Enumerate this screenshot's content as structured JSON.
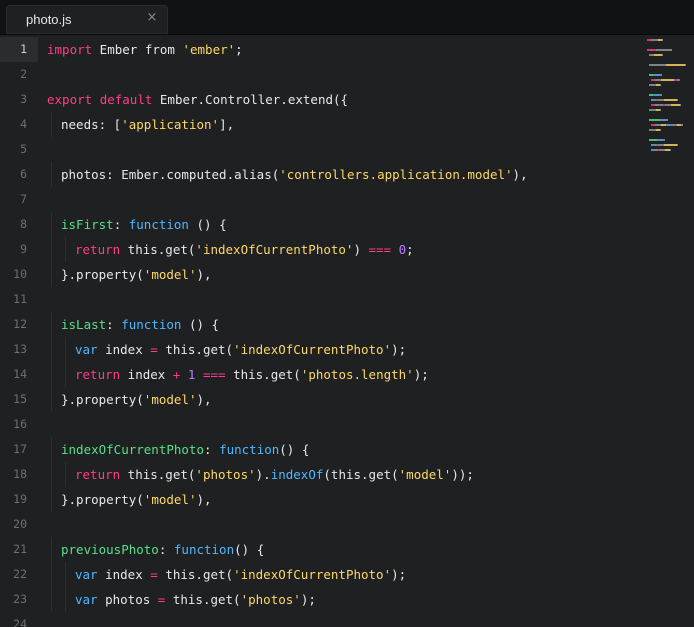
{
  "tab": {
    "title": "photo.js",
    "close_glyph": "×"
  },
  "editor": {
    "active_line": 1,
    "lines": [
      {
        "n": "1",
        "indent": 0,
        "tokens": [
          [
            "kw",
            "import"
          ],
          [
            "txt",
            " Ember "
          ],
          [
            "txt",
            "from "
          ],
          [
            "str",
            "'ember'"
          ],
          [
            "txt",
            ";"
          ]
        ]
      },
      {
        "n": "2",
        "indent": 0,
        "tokens": []
      },
      {
        "n": "3",
        "indent": 0,
        "tokens": [
          [
            "kw",
            "export"
          ],
          [
            "txt",
            " "
          ],
          [
            "kw",
            "default"
          ],
          [
            "txt",
            " Ember.Controller.extend({"
          ]
        ]
      },
      {
        "n": "4",
        "indent": 1,
        "tokens": [
          [
            "txt",
            "needs: ["
          ],
          [
            "str",
            "'application'"
          ],
          [
            "txt",
            "],"
          ]
        ]
      },
      {
        "n": "5",
        "indent": 0,
        "tokens": []
      },
      {
        "n": "6",
        "indent": 1,
        "tokens": [
          [
            "txt",
            "photos: Ember.computed.alias("
          ],
          [
            "str",
            "'controllers.application.model'"
          ],
          [
            "txt",
            "),"
          ]
        ]
      },
      {
        "n": "7",
        "indent": 0,
        "tokens": []
      },
      {
        "n": "8",
        "indent": 1,
        "tokens": [
          [
            "prop",
            "isFirst"
          ],
          [
            "txt",
            ": "
          ],
          [
            "fn",
            "function"
          ],
          [
            "txt",
            " () {"
          ]
        ]
      },
      {
        "n": "9",
        "indent": 2,
        "tokens": [
          [
            "kw",
            "return"
          ],
          [
            "txt",
            " this.get("
          ],
          [
            "str",
            "'indexOfCurrentPhoto'"
          ],
          [
            "txt",
            ") "
          ],
          [
            "op",
            "==="
          ],
          [
            "txt",
            " "
          ],
          [
            "num",
            "0"
          ],
          [
            "txt",
            ";"
          ]
        ]
      },
      {
        "n": "10",
        "indent": 1,
        "tokens": [
          [
            "txt",
            "}.property("
          ],
          [
            "str",
            "'model'"
          ],
          [
            "txt",
            "),"
          ]
        ]
      },
      {
        "n": "11",
        "indent": 0,
        "tokens": []
      },
      {
        "n": "12",
        "indent": 1,
        "tokens": [
          [
            "prop",
            "isLast"
          ],
          [
            "txt",
            ": "
          ],
          [
            "fn",
            "function"
          ],
          [
            "txt",
            " () {"
          ]
        ]
      },
      {
        "n": "13",
        "indent": 2,
        "tokens": [
          [
            "fn",
            "var"
          ],
          [
            "txt",
            " index "
          ],
          [
            "op",
            "="
          ],
          [
            "txt",
            " this.get("
          ],
          [
            "str",
            "'indexOfCurrentPhoto'"
          ],
          [
            "txt",
            ");"
          ]
        ]
      },
      {
        "n": "14",
        "indent": 2,
        "tokens": [
          [
            "kw",
            "return"
          ],
          [
            "txt",
            " index "
          ],
          [
            "op",
            "+"
          ],
          [
            "txt",
            " "
          ],
          [
            "num",
            "1"
          ],
          [
            "txt",
            " "
          ],
          [
            "op",
            "==="
          ],
          [
            "txt",
            " this.get("
          ],
          [
            "str",
            "'photos.length'"
          ],
          [
            "txt",
            ");"
          ]
        ]
      },
      {
        "n": "15",
        "indent": 1,
        "tokens": [
          [
            "txt",
            "}.property("
          ],
          [
            "str",
            "'model'"
          ],
          [
            "txt",
            "),"
          ]
        ]
      },
      {
        "n": "16",
        "indent": 0,
        "tokens": []
      },
      {
        "n": "17",
        "indent": 1,
        "tokens": [
          [
            "prop",
            "indexOfCurrentPhoto"
          ],
          [
            "txt",
            ": "
          ],
          [
            "fn",
            "function"
          ],
          [
            "txt",
            "() {"
          ]
        ]
      },
      {
        "n": "18",
        "indent": 2,
        "tokens": [
          [
            "kw",
            "return"
          ],
          [
            "txt",
            " this.get("
          ],
          [
            "str",
            "'photos'"
          ],
          [
            "txt",
            ")."
          ],
          [
            "meth",
            "indexOf"
          ],
          [
            "txt",
            "(this.get("
          ],
          [
            "str",
            "'model'"
          ],
          [
            "txt",
            "));"
          ]
        ]
      },
      {
        "n": "19",
        "indent": 1,
        "tokens": [
          [
            "txt",
            "}.property("
          ],
          [
            "str",
            "'model'"
          ],
          [
            "txt",
            "),"
          ]
        ]
      },
      {
        "n": "20",
        "indent": 0,
        "tokens": []
      },
      {
        "n": "21",
        "indent": 1,
        "tokens": [
          [
            "prop",
            "previousPhoto"
          ],
          [
            "txt",
            ": "
          ],
          [
            "fn",
            "function"
          ],
          [
            "txt",
            "() {"
          ]
        ]
      },
      {
        "n": "22",
        "indent": 2,
        "tokens": [
          [
            "fn",
            "var"
          ],
          [
            "txt",
            " index "
          ],
          [
            "op",
            "="
          ],
          [
            "txt",
            " this.get("
          ],
          [
            "str",
            "'indexOfCurrentPhoto'"
          ],
          [
            "txt",
            ");"
          ]
        ]
      },
      {
        "n": "23",
        "indent": 2,
        "tokens": [
          [
            "fn",
            "var"
          ],
          [
            "txt",
            " photos "
          ],
          [
            "op",
            "="
          ],
          [
            "txt",
            " this.get("
          ],
          [
            "str",
            "'photos'"
          ],
          [
            "txt",
            ");"
          ]
        ]
      },
      {
        "n": "24",
        "indent": 0,
        "tokens": []
      }
    ]
  },
  "colors": {
    "keyword": "#ff3c8a",
    "function": "#4fb7ff",
    "string": "#ffd866",
    "property": "#58e08a",
    "number": "#b67dff",
    "background": "#1e2022"
  }
}
